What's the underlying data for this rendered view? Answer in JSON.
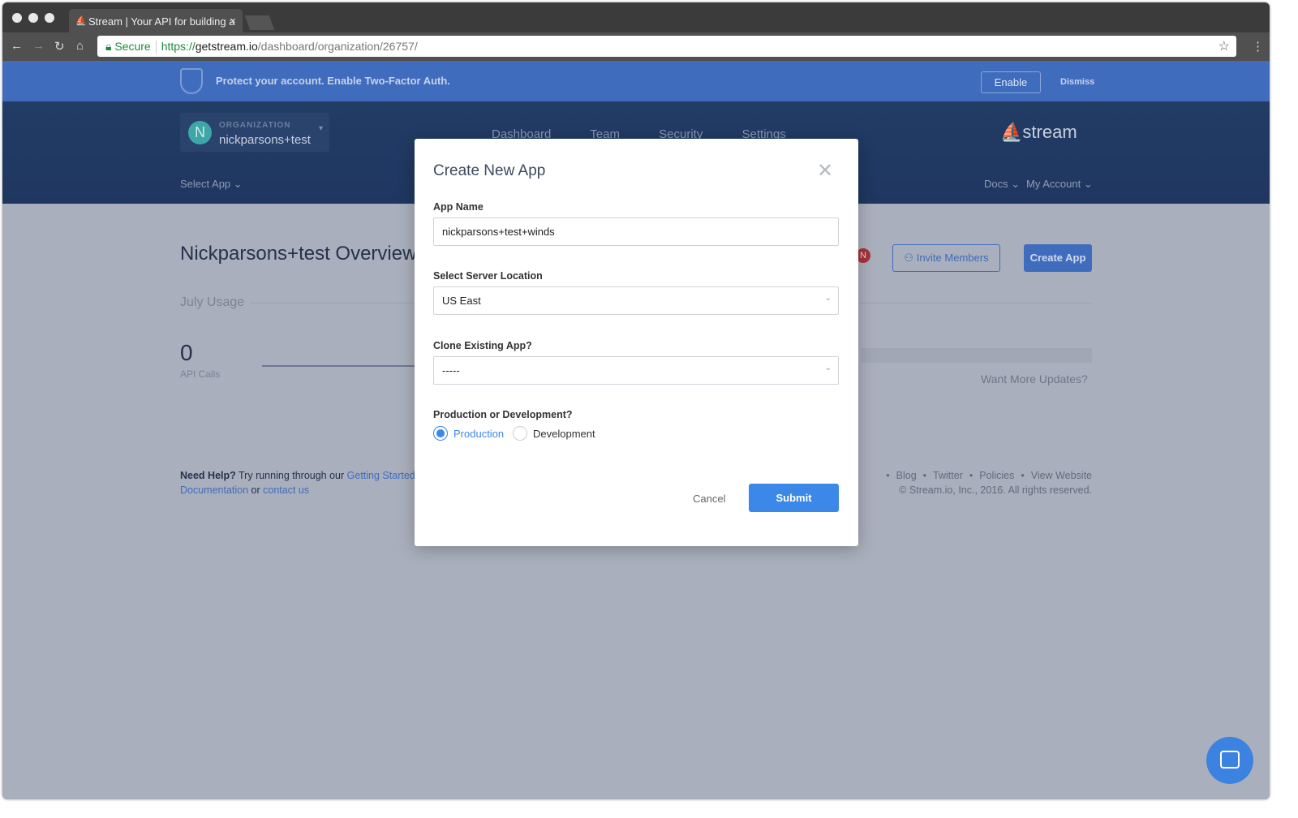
{
  "browser": {
    "tab_title": "Stream | Your API for building a",
    "url_secure": "Secure",
    "url_scheme": "https://",
    "url_host": "getstream.io",
    "url_path": "/dashboard/organization/26757/"
  },
  "banner": {
    "message": "Protect your account. Enable Two-Factor Auth.",
    "enable": "Enable",
    "dismiss": "Dismiss"
  },
  "header": {
    "org_label": "ORGANIZATION",
    "org_name": "nickparsons+test",
    "avatar": "N",
    "nav": [
      "Dashboard",
      "Team",
      "Security",
      "Settings"
    ],
    "logo": "stream",
    "select_app": "Select App",
    "docs": "Docs",
    "my_account": "My Account"
  },
  "main": {
    "title": "Nickparsons+test Overview",
    "usage_title": "July Usage",
    "api_calls_value": "0",
    "api_calls_label": "API Calls",
    "want_updates": "Want More Updates?",
    "badge": "N",
    "invite": "Invite Members",
    "create_app": "Create App"
  },
  "help": {
    "bold": "Need Help?",
    "text": " Try running through our ",
    "link1": "Getting Started",
    "link2": "Documentation",
    "or": " or ",
    "link3": "contact us"
  },
  "footer": {
    "links": [
      "Blog",
      "Twitter",
      "Policies",
      "View Website"
    ],
    "copyright": "© Stream.io, Inc., 2016. All rights reserved."
  },
  "modal": {
    "title": "Create New App",
    "app_name_label": "App Name",
    "app_name_value": "nickparsons+test+winds",
    "server_label": "Select Server Location",
    "server_value": "US East",
    "clone_label": "Clone Existing App?",
    "clone_value": "-----",
    "env_label": "Production or Development?",
    "env_options": [
      "Production",
      "Development"
    ],
    "env_selected": "Production",
    "cancel": "Cancel",
    "submit": "Submit"
  }
}
